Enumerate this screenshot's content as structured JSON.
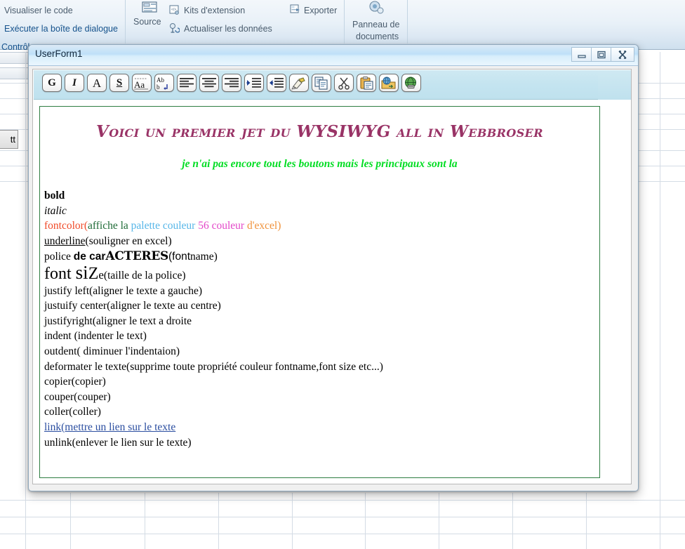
{
  "ribbon": {
    "items": [
      {
        "label": "Visualiser le code",
        "style": "grey"
      },
      {
        "label": "Exécuter la boîte de dialogue",
        "style": "blue"
      },
      {
        "label": "Contrôl",
        "style": "blue"
      },
      {
        "label": "Source",
        "style": "grey"
      },
      {
        "label": "Kits d'extension",
        "style": "grey"
      },
      {
        "label": "Actualiser les données",
        "style": "grey"
      },
      {
        "label": "Exporter",
        "style": "grey"
      },
      {
        "label": "Panneau de",
        "style": "grey"
      },
      {
        "label": "documents",
        "style": "grey"
      }
    ],
    "cell_button_label": "tt"
  },
  "window": {
    "title": "UserForm1",
    "minimize": "minimize-icon",
    "maximize": "maximize-icon",
    "close": "close-icon"
  },
  "toolbar": {
    "buttons": [
      {
        "name": "bold-button",
        "glyph": "G",
        "cls": "g",
        "tip": "bold"
      },
      {
        "name": "italic-button",
        "glyph": "I",
        "cls": "i",
        "tip": "italic"
      },
      {
        "name": "fontname-button",
        "glyph": "A",
        "cls": "a",
        "tip": "font name"
      },
      {
        "name": "underline-button",
        "glyph": "S",
        "cls": "s",
        "tip": "underline"
      },
      {
        "name": "fontsize-button",
        "glyph": "Aa",
        "cls": "aa",
        "tip": "font size"
      },
      {
        "name": "change-case-button",
        "glyph": "",
        "cls": "svg-case",
        "tip": "change case"
      },
      {
        "name": "align-left-button",
        "glyph": "",
        "cls": "svg-alignleft",
        "tip": "justify left"
      },
      {
        "name": "align-center-button",
        "glyph": "",
        "cls": "svg-aligncenter",
        "tip": "justify center"
      },
      {
        "name": "align-right-button",
        "glyph": "",
        "cls": "svg-alignright",
        "tip": "justify right"
      },
      {
        "name": "indent-button",
        "glyph": "",
        "cls": "svg-indent",
        "tip": "indent"
      },
      {
        "name": "outdent-button",
        "glyph": "",
        "cls": "svg-outdent",
        "tip": "outdent"
      },
      {
        "name": "clear-format-button",
        "glyph": "",
        "cls": "svg-brush",
        "tip": "deformater"
      },
      {
        "name": "copy-button",
        "glyph": "",
        "cls": "svg-copy",
        "tip": "copier"
      },
      {
        "name": "cut-button",
        "glyph": "",
        "cls": "svg-cut",
        "tip": "couper"
      },
      {
        "name": "paste-button",
        "glyph": "",
        "cls": "svg-paste",
        "tip": "coller"
      },
      {
        "name": "link-button",
        "glyph": "",
        "cls": "svg-link",
        "tip": "link"
      },
      {
        "name": "unlink-button",
        "glyph": "",
        "cls": "svg-unlink",
        "tip": "unlink"
      }
    ]
  },
  "editor": {
    "heading": "Voici un premier jet du WYSIWYG all in Webbroser",
    "subheading": "je n'ai pas encore tout les boutons mais les principaux sont la",
    "line_bold": "bold",
    "line_italic": "italic",
    "fontcolor": {
      "p1": "fontcolor(",
      "p2": "affiche la ",
      "p3": "palette couleur ",
      "p4": " 56 couleur ",
      "p5": "d'excel)"
    },
    "underline": {
      "p1": "underline",
      "p2": "(souligner en excel)"
    },
    "police": {
      "p1": "police ",
      "p2": "de car",
      "p3": "ACTERES",
      "p4": "(font",
      "p5": "name)"
    },
    "fontsize": {
      "p1": "font ",
      "p2": "si",
      "p3": "Z",
      "p4": "e",
      "p5": "(taille de la police)"
    },
    "simple_lines": [
      "justify left(aligner le texte a gauche)",
      "justuify center(aligner le texte au centre)",
      "justifyright(aligner le text a droite",
      "indent (indenter le text)",
      "outdent( diminuer l'indentaion)",
      "deformater le texte(supprime toute propriété couleur fontname,font size etc...)",
      "copier(copier)",
      "couper(couper)",
      "coller(coller)"
    ],
    "link_line": "link(mettre un lien sur le texte",
    "unlink_line": "unlink(enlever le lien sur le texte)"
  },
  "colors": {
    "heading": "#993366",
    "subheading": "#00dd22",
    "fontcolor_red": "#f04a28",
    "affiche_green": "#1f6b37",
    "palette_blue": "#56b6e8",
    "magenta": "#e347c9",
    "orange": "#f0923b",
    "link_blue": "#2b4ea0",
    "editor_border": "#2e7d41"
  }
}
